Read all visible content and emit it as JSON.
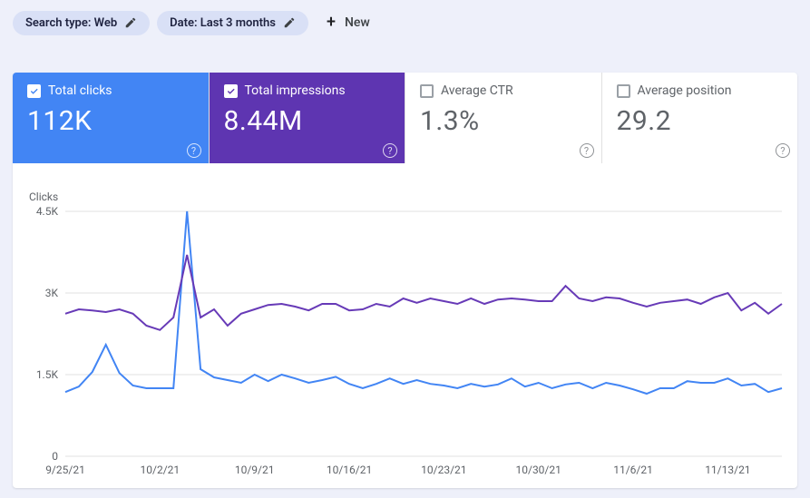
{
  "filters": {
    "search_type": "Search type: Web",
    "date": "Date: Last 3 months",
    "new_label": "New"
  },
  "metrics": {
    "clicks": {
      "label": "Total clicks",
      "value": "112K",
      "checked": true
    },
    "impressions": {
      "label": "Total impressions",
      "value": "8.44M",
      "checked": true
    },
    "ctr": {
      "label": "Average CTR",
      "value": "1.3%",
      "checked": false
    },
    "position": {
      "label": "Average position",
      "value": "29.2",
      "checked": false
    }
  },
  "chart_data": {
    "type": "line",
    "title": "",
    "xlabel": "",
    "ylabel": "Clicks",
    "ylim": [
      0,
      4500
    ],
    "y_ticks": [
      0,
      1500,
      3000,
      4500
    ],
    "y_tick_labels": [
      "0",
      "1.5K",
      "3K",
      "4.5K"
    ],
    "x_tick_labels": [
      "9/25/21",
      "10/2/21",
      "10/9/21",
      "10/16/21",
      "10/23/21",
      "10/30/21",
      "11/6/21",
      "11/13/21"
    ],
    "x_dates": [
      "9/25/21",
      "9/26/21",
      "9/27/21",
      "9/28/21",
      "9/29/21",
      "9/30/21",
      "10/1/21",
      "10/2/21",
      "10/3/21",
      "10/4/21",
      "10/5/21",
      "10/6/21",
      "10/7/21",
      "10/8/21",
      "10/9/21",
      "10/10/21",
      "10/11/21",
      "10/12/21",
      "10/13/21",
      "10/14/21",
      "10/15/21",
      "10/16/21",
      "10/17/21",
      "10/18/21",
      "10/19/21",
      "10/20/21",
      "10/21/21",
      "10/22/21",
      "10/23/21",
      "10/24/21",
      "10/25/21",
      "10/26/21",
      "10/27/21",
      "10/28/21",
      "10/29/21",
      "10/30/21",
      "10/31/21",
      "11/1/21",
      "11/2/21",
      "11/3/21",
      "11/4/21",
      "11/5/21",
      "11/6/21",
      "11/7/21",
      "11/8/21",
      "11/9/21",
      "11/10/21",
      "11/11/21",
      "11/12/21",
      "11/13/21",
      "11/14/21",
      "11/15/21",
      "11/16/21",
      "11/17/21"
    ],
    "series": [
      {
        "name": "Total clicks",
        "color": "#4285f4",
        "values": [
          1180,
          1280,
          1550,
          2050,
          1530,
          1300,
          1250,
          1250,
          1250,
          4500,
          1600,
          1450,
          1400,
          1350,
          1500,
          1380,
          1500,
          1430,
          1350,
          1400,
          1460,
          1330,
          1250,
          1330,
          1430,
          1330,
          1400,
          1330,
          1300,
          1250,
          1330,
          1280,
          1320,
          1430,
          1280,
          1350,
          1250,
          1320,
          1350,
          1250,
          1350,
          1300,
          1230,
          1150,
          1250,
          1250,
          1380,
          1350,
          1350,
          1430,
          1300,
          1330,
          1180,
          1250
        ]
      },
      {
        "name": "Total impressions",
        "color": "#673ab7",
        "values": [
          2620,
          2700,
          2680,
          2650,
          2700,
          2620,
          2400,
          2320,
          2550,
          3700,
          2550,
          2700,
          2400,
          2620,
          2700,
          2780,
          2800,
          2750,
          2680,
          2800,
          2800,
          2680,
          2700,
          2800,
          2750,
          2900,
          2820,
          2900,
          2850,
          2800,
          2900,
          2800,
          2880,
          2900,
          2880,
          2850,
          2850,
          3130,
          2900,
          2850,
          2920,
          2900,
          2820,
          2750,
          2820,
          2850,
          2880,
          2800,
          2920,
          3000,
          2680,
          2820,
          2620,
          2800
        ]
      }
    ]
  }
}
